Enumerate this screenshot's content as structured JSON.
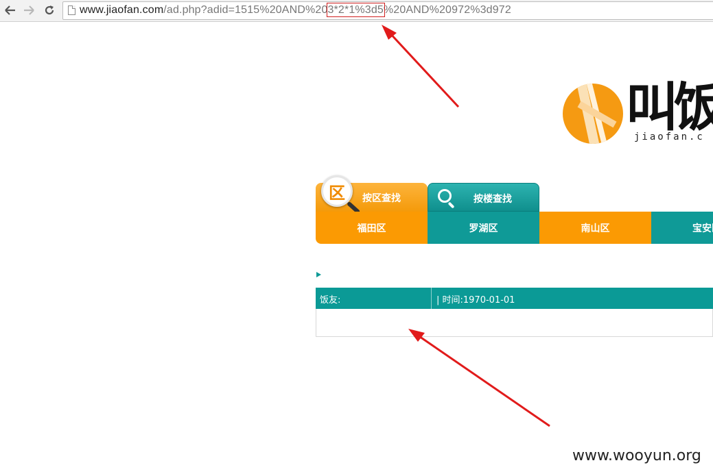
{
  "browser": {
    "back_icon": "arrow-left-icon",
    "forward_icon": "arrow-right-icon",
    "reload_icon": "reload-icon",
    "page_icon": "page-icon",
    "url_host": "www.jiaofan.com",
    "url_path_before": "/ad.php?adid=1515%20AND%20",
    "url_highlight": "3*2*1%3d5",
    "url_path_after": "%20AND%20972%3d972"
  },
  "logo": {
    "calligraphy": "叫饭",
    "domain_text": "jiaofan.c"
  },
  "search_tabs": [
    {
      "label": "按区查找",
      "icon": "district-magnifier-icon",
      "icon_glyph": "区"
    },
    {
      "label": "按楼查找",
      "icon": "search-icon"
    }
  ],
  "districts": [
    "福田区",
    "罗湖区",
    "南山区",
    "宝安区"
  ],
  "review": {
    "user_label": "饭友:",
    "time_label": "| 时间:1970-01-01"
  },
  "watermark": "www.wooyun.org",
  "colors": {
    "orange": "#fb9a03",
    "teal": "#0f9a97",
    "annotation_red": "#e11b1b"
  }
}
